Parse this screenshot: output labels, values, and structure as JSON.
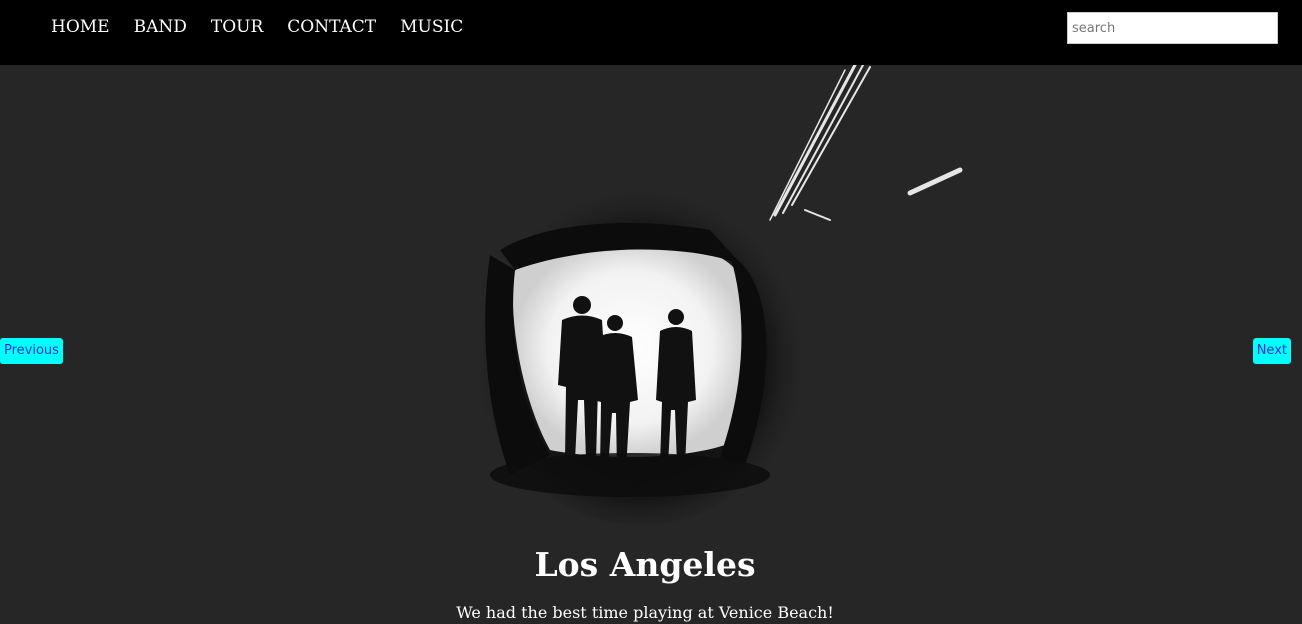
{
  "nav": {
    "items": [
      {
        "label": "HOME"
      },
      {
        "label": "BAND"
      },
      {
        "label": "TOUR"
      },
      {
        "label": "CONTACT"
      },
      {
        "label": "MUSIC"
      }
    ],
    "search_placeholder": "search"
  },
  "slide": {
    "image_icon": "band-silhouette-tunnel-image",
    "prev_label": "Previous",
    "next_label": "Next",
    "title": "Los Angeles",
    "caption": "We had the best time playing at Venice Beach!"
  },
  "colors": {
    "navbar_bg": "#000000",
    "page_bg": "#262626",
    "button_bg": "#00ffff",
    "button_text": "#1a2fd6"
  }
}
